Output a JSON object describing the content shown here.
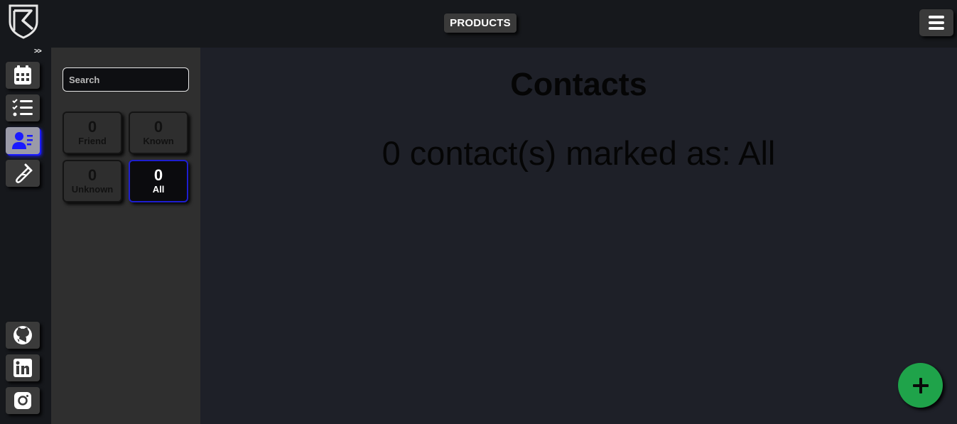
{
  "header": {
    "products_label": "PRODUCTS",
    "expand_label": ">>"
  },
  "rail": {
    "items": [
      {
        "name": "calendar",
        "icon": "calendar-icon"
      },
      {
        "name": "tasks",
        "icon": "checklist-icon"
      },
      {
        "name": "contacts",
        "icon": "contact-card-icon",
        "active": true
      },
      {
        "name": "tools",
        "icon": "test-tube-icon"
      }
    ],
    "social": [
      {
        "name": "github",
        "icon": "github-icon"
      },
      {
        "name": "linkedin",
        "icon": "linkedin-icon"
      },
      {
        "name": "instagram",
        "icon": "instagram-icon"
      }
    ]
  },
  "filters": {
    "search_placeholder": "Search",
    "cards": [
      {
        "count": "0",
        "label": "Friend"
      },
      {
        "count": "0",
        "label": "Known"
      },
      {
        "count": "0",
        "label": "Unknown"
      },
      {
        "count": "0",
        "label": "All",
        "active": true
      }
    ]
  },
  "main": {
    "title": "Contacts",
    "summary": "0 contact(s) marked as: All"
  },
  "colors": {
    "accent": "#1e1ed0",
    "fab": "#1fa34a",
    "background": "#1e2028"
  }
}
